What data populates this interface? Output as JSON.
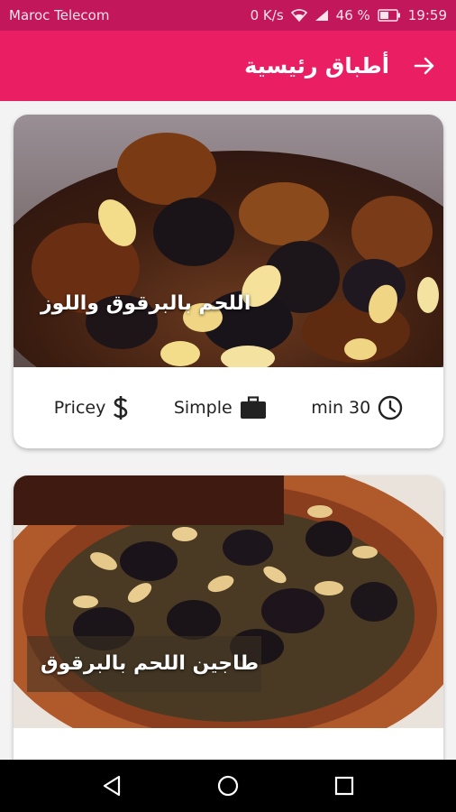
{
  "status_bar": {
    "carrier": "Maroc Telecom",
    "speed": "0 K/s",
    "battery": "46 %",
    "time": "19:59"
  },
  "app_bar": {
    "title": "أطباق رئيسية",
    "back_icon": "arrow-right-icon"
  },
  "recipes": [
    {
      "title": "اللحم بالبرقوق واللوز",
      "cost": "Pricey",
      "difficulty": "Simple",
      "duration": "min 30",
      "cost_icon": "dollar-icon",
      "difficulty_icon": "briefcase-icon",
      "duration_icon": "clock-icon"
    },
    {
      "title": "طاجين اللحم بالبرقوق"
    }
  ],
  "nav_bar": {
    "back_icon": "triangle-back-icon",
    "home_icon": "circle-home-icon",
    "recents_icon": "square-recents-icon"
  },
  "colors": {
    "status_bar": "#c2185b",
    "app_bar": "#e91e63",
    "background": "#f3f3f3"
  }
}
